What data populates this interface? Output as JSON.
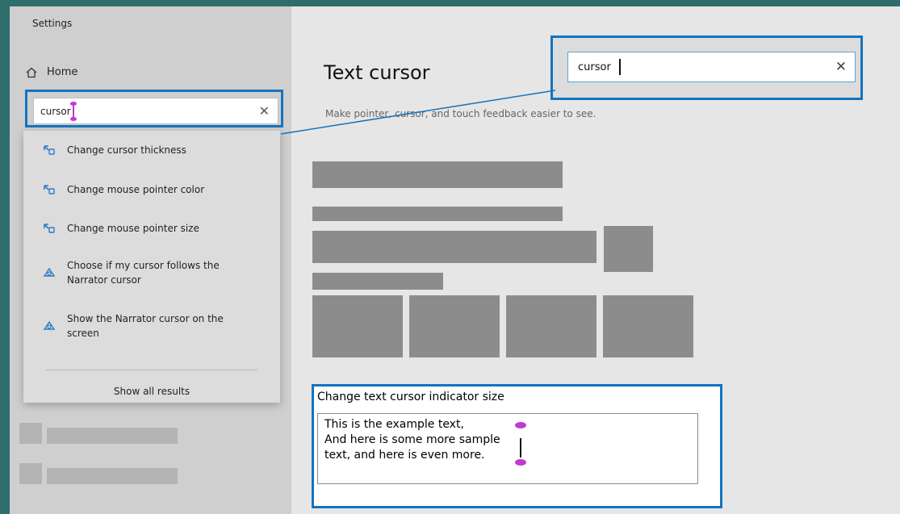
{
  "app": {
    "title": "Settings"
  },
  "nav": {
    "home_label": "Home"
  },
  "search": {
    "value": "cursor",
    "clear_icon": "close-icon"
  },
  "results": [
    {
      "label": "Change cursor thickness",
      "icon": "pointer-settings-icon"
    },
    {
      "label": "Change mouse pointer color",
      "icon": "pointer-settings-icon"
    },
    {
      "label": "Change mouse pointer size",
      "icon": "pointer-settings-icon"
    },
    {
      "label": "Choose if my cursor follows the Narrator cursor",
      "icon": "narrator-icon"
    },
    {
      "label": "Show the Narrator cursor on the screen",
      "icon": "narrator-icon"
    }
  ],
  "show_all_label": "Show all results",
  "page": {
    "title": "Text cursor",
    "subtitle": "Make pointer, cursor, and touch feedback easier to see."
  },
  "zoom_search": {
    "value": "cursor"
  },
  "callout": {
    "title": "Change text cursor indicator size",
    "example_lines": [
      "This is the example text,",
      "And here is some more sample",
      "text, and here is even more."
    ]
  },
  "colors": {
    "accent": "#1573bf",
    "indicator": "#c23ad0",
    "icon_blue": "#2b7cc4"
  }
}
